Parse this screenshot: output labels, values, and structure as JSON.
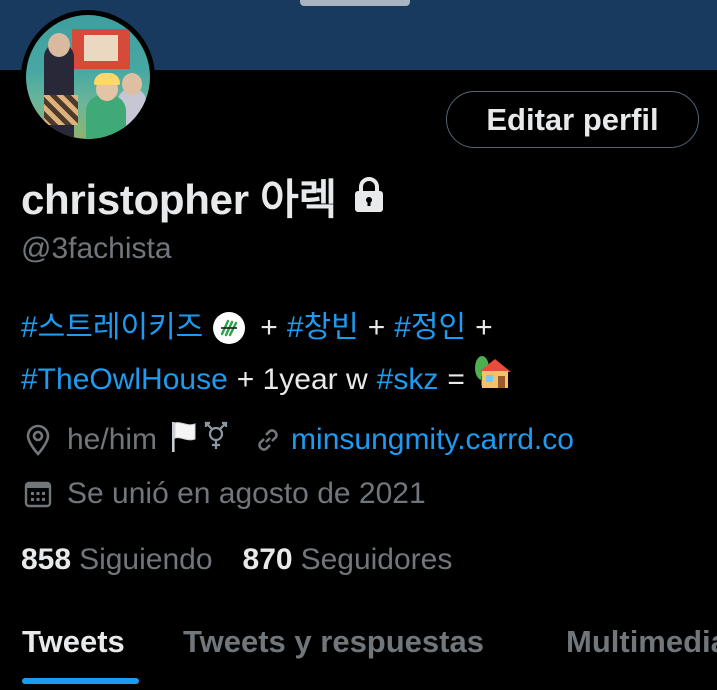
{
  "profile": {
    "name": "christopher 아렉",
    "handle": "@3fachista",
    "edit_button_label": "Editar perfil",
    "bio": {
      "line1": {
        "tag1": "#스트레이키즈",
        "plus1": "+",
        "tag2": "#창빈",
        "plus2": "+",
        "tag3": "#정인",
        "plus3": "+"
      },
      "line2": {
        "tag4": "#TheOwlHouse",
        "text1": "+ 1year w",
        "tag5": "#skz",
        "equals": "="
      }
    },
    "pronouns": "he/him",
    "website": "minsungmity.carrd.co",
    "joined": "Se unió en agosto de 2021",
    "following_count": "858",
    "following_label": "Siguiendo",
    "followers_count": "870",
    "followers_label": "Seguidores"
  },
  "tabs": [
    {
      "label": "Tweets",
      "active": true
    },
    {
      "label": "Tweets y respuestas",
      "active": false
    },
    {
      "label": "Multimedia",
      "active": false
    }
  ],
  "icons": {
    "lock": "lock-icon",
    "location": "location-pin-icon",
    "link": "link-icon",
    "calendar": "calendar-icon",
    "house": "house-emoji-icon",
    "white_flag": "white-flag-emoji-icon",
    "transgender": "transgender-symbol-icon",
    "skz_logo": "skz-logo-icon"
  },
  "colors": {
    "background": "#000000",
    "banner": "#173a5e",
    "accent": "#1d9bf0",
    "text_primary": "#e7e9ea",
    "text_secondary": "#71767b",
    "border": "#536471"
  }
}
